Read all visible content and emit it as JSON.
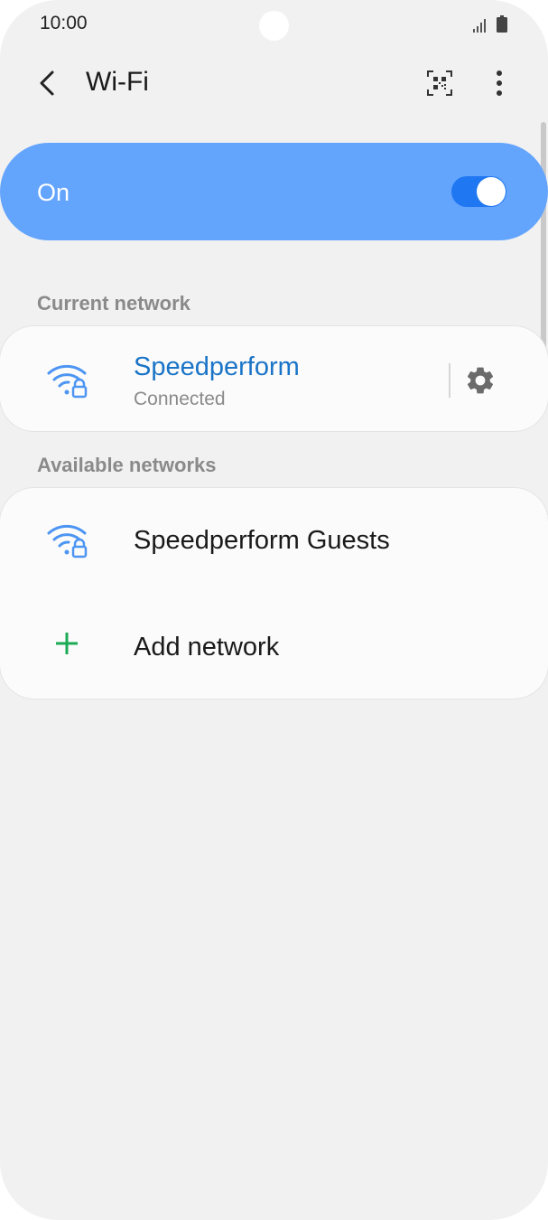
{
  "status_bar": {
    "time": "10:00"
  },
  "app_bar": {
    "title": "Wi-Fi"
  },
  "master_switch": {
    "label": "On",
    "enabled": true
  },
  "sections": {
    "current_header": "Current network",
    "available_header": "Available networks"
  },
  "current_network": {
    "name": "Speedperform",
    "status": "Connected"
  },
  "available_networks": [
    {
      "name": "Speedperform Guests"
    }
  ],
  "add_network": {
    "label": "Add network"
  },
  "colors": {
    "accent": "#63a4fd",
    "toggle_track": "#1f77f1",
    "connected_text": "#1a74c7",
    "wifi_icon": "#4d95f2",
    "add_icon": "#1bab55",
    "background": "#f1f1f1"
  },
  "icons": {
    "back": "back-arrow-icon",
    "qr": "qr-scan-icon",
    "more": "more-options-icon",
    "wifi_locked": "wifi-lock-icon",
    "settings": "gear-icon",
    "add": "plus-icon"
  }
}
